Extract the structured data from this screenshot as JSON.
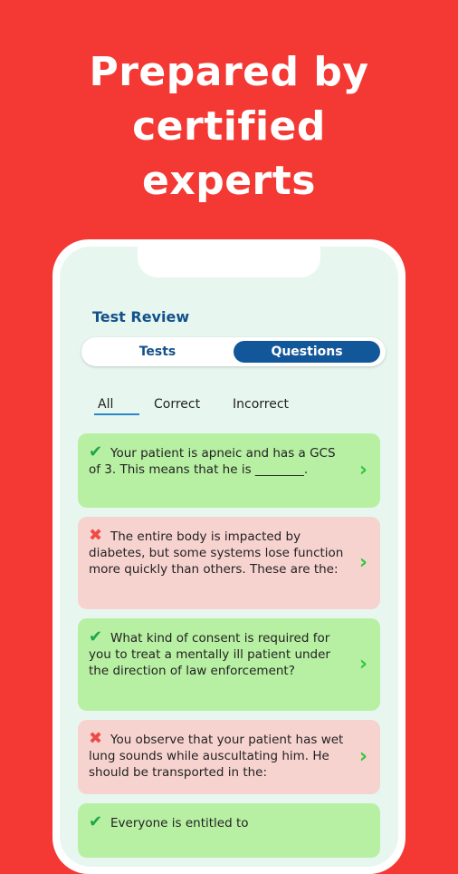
{
  "headline": [
    "Prepared by",
    "certified",
    "experts"
  ],
  "screen": {
    "title": "Test Review",
    "tabs": [
      "Tests",
      "Questions"
    ],
    "active_tab": "Questions",
    "filters": [
      "All",
      "Correct",
      "Incorrect"
    ],
    "active_filter": "All",
    "questions": [
      {
        "status": "correct",
        "text": "Your patient is apneic and has a GCS of 3. This means that he is ________."
      },
      {
        "status": "incorrect",
        "text": "The entire body is impacted by diabetes, but some systems lose function more quickly than others. These are the:"
      },
      {
        "status": "correct",
        "text": "What kind of consent is required for you to treat a mentally ill patient under the direction of law enforcement?"
      },
      {
        "status": "incorrect",
        "text": "You observe that your patient has wet lung sounds while auscultating him. He should be transported in the:"
      },
      {
        "status": "correct",
        "text": "Everyone is entitled to"
      }
    ]
  },
  "colors": {
    "background": "#f43833",
    "primary": "#13579b",
    "correct_card": "#b8f0a3",
    "incorrect_card": "#f7d3d0",
    "chevron": "#2ec83b"
  },
  "icons": {
    "correct": "check-icon",
    "incorrect": "cross-icon",
    "chevron": "chevron-right-icon"
  }
}
